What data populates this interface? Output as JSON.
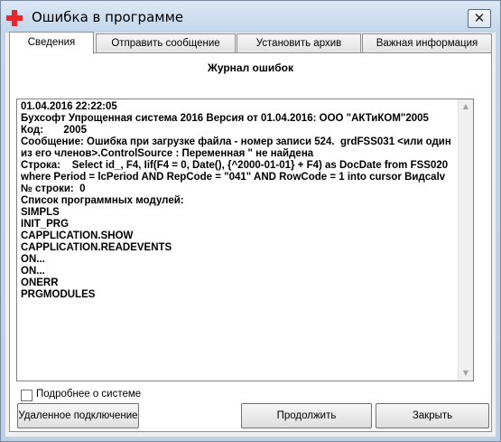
{
  "window": {
    "title": "Ошибка в программе",
    "close_glyph": "✕"
  },
  "tabs": [
    {
      "label": "Сведения",
      "active": true
    },
    {
      "label": "Отправить сообщение",
      "active": false
    },
    {
      "label": "Установить архив",
      "active": false
    },
    {
      "label": "Важная информация",
      "active": false
    }
  ],
  "main": {
    "section_title": "Журнал ошибок",
    "log_text": "01.04.2016 22:22:05\nБухсофт Упрощенная система 2016 Версия от 01.04.2016: ООО \"АКТиКОМ\"2005\nКод:       2005\nСообщение: Ошибка при загрузке файла - номер записи 524.  grdFSS031 <или один из его членов>.ControlSource : Переменная \" не найдена\nСтрока:    Select id_, F4, Iif(F4 = 0, Date(), {^2000-01-01} + F4) as DocDate from FSS020 where Period = lcPeriod AND RepCode = \"041\" AND RowCode = 1 into cursor Видcalv\n№ строки:  0\nСписок программных модулей:\nSIMPLS\nINIT_PRG\nCAPPLICATION.SHOW\nCAPPLICATION.READEVENTS\nON...\nON...\nONERR\nPRGMODULES",
    "scroll_up": "▲",
    "scroll_down": "▼"
  },
  "footer": {
    "checkbox_label": "Подробнее о системе",
    "checkbox_checked": false,
    "remote_button": "Удаленное подключение",
    "continue_button": "Продолжить",
    "close_button": "Закрыть"
  },
  "colors": {
    "app_icon": "#e8262b"
  }
}
